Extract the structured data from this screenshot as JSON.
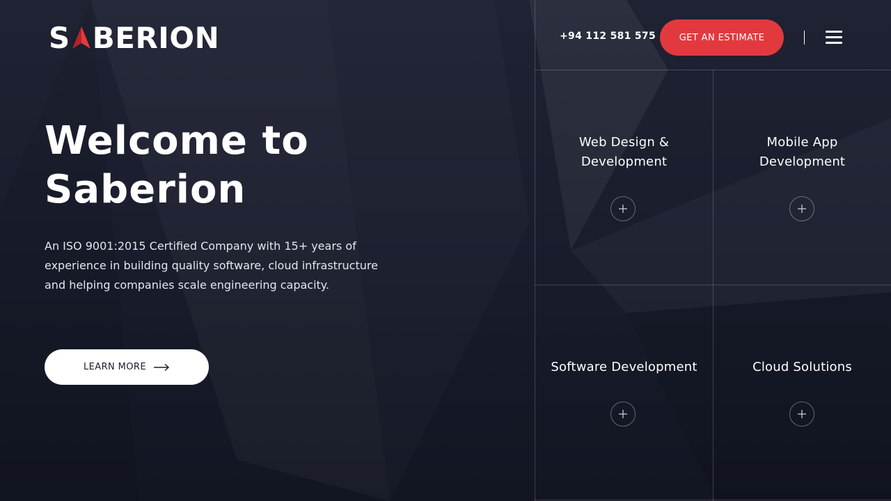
{
  "brand": {
    "logo_text_start": "S",
    "logo_text_end": "BERION",
    "logo_alt": "SABERION",
    "accent_color": "#e2393f"
  },
  "header": {
    "phone": "+94 112 581 575",
    "estimate_label": "GET AN ESTIMATE",
    "menu_icon": "hamburger-icon"
  },
  "hero": {
    "title_line1": "Welcome to",
    "title_line2": "Saberion",
    "description": "An ISO 9001:2015 Certified Company with 15+ years of experience in building quality software, cloud infrastructure and helping companies scale engineering capacity.",
    "cta_label": "LEARN MORE",
    "cta_icon": "arrow-right-icon"
  },
  "services": [
    {
      "line1": "Web Design &",
      "line2": "Development",
      "icon": "plus-icon"
    },
    {
      "line1": "Mobile App",
      "line2": "Development",
      "icon": "plus-icon"
    },
    {
      "line1": "Software Development",
      "line2": "",
      "icon": "plus-icon"
    },
    {
      "line1": "Cloud Solutions",
      "line2": "",
      "icon": "plus-icon"
    }
  ]
}
